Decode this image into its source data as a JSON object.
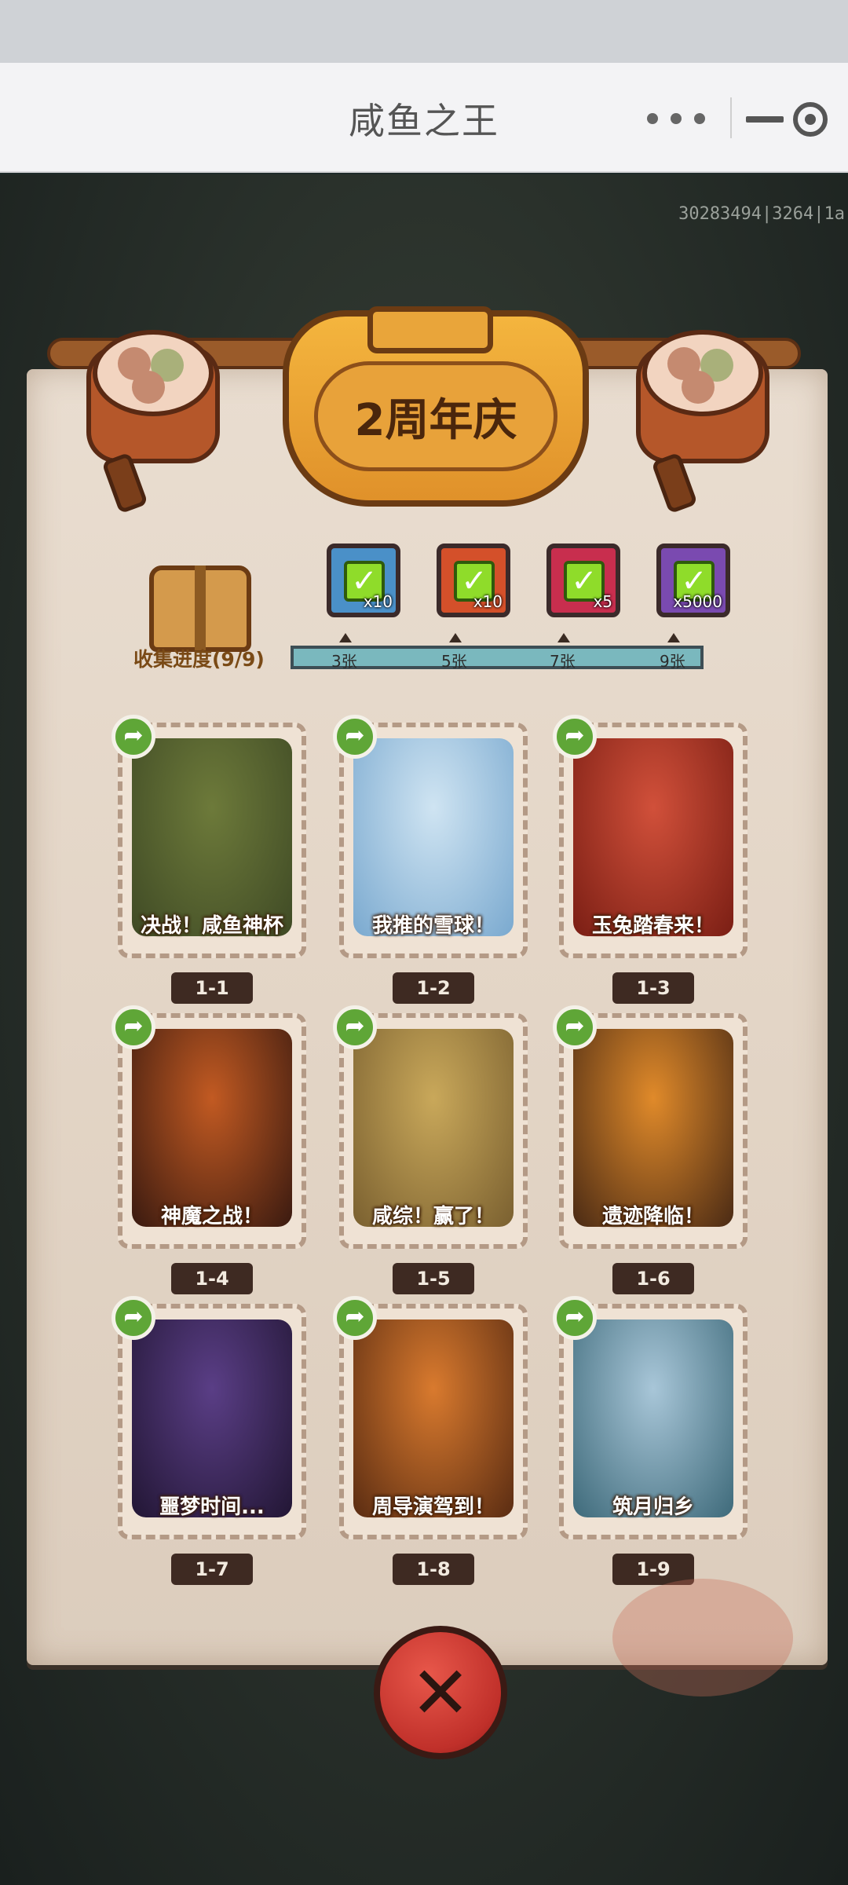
{
  "window": {
    "title": "咸鱼之王",
    "more_icon": "more-dots-icon",
    "minimize_icon": "minimize-icon",
    "close_icon": "target-close-icon"
  },
  "user_id": "30283494|3264|1a",
  "event": {
    "banner_title": "2周年庆"
  },
  "progress": {
    "label": "收集进度(9/9)",
    "collected": 9,
    "total": 9,
    "milestones": [
      {
        "reward_icon": "equipment-chest-icon",
        "qty": "x10",
        "tick": "3张",
        "claimed": true
      },
      {
        "reward_icon": "key-chest-icon",
        "qty": "x10",
        "tick": "5张",
        "claimed": true
      },
      {
        "reward_icon": "gem-egg-icon",
        "qty": "x5",
        "tick": "7张",
        "claimed": true
      },
      {
        "reward_icon": "silver-ingot-icon",
        "qty": "x5000",
        "tick": "9张",
        "claimed": true
      }
    ]
  },
  "cards": [
    {
      "caption": "决战！咸鱼神杯",
      "level": "1-1",
      "bg": [
        "#6d7a3a",
        "#3f4a25"
      ]
    },
    {
      "caption": "我推的雪球！",
      "level": "1-2",
      "bg": [
        "#cfe4f2",
        "#7aa9cf"
      ]
    },
    {
      "caption": "玉兔踏春来！",
      "level": "1-3",
      "bg": [
        "#d1503a",
        "#7a1e14"
      ]
    },
    {
      "caption": "神魔之战！",
      "level": "1-4",
      "bg": [
        "#c25a22",
        "#3a1a10"
      ]
    },
    {
      "caption": "咸综！赢了！",
      "level": "1-5",
      "bg": [
        "#c9a85a",
        "#7a6030"
      ]
    },
    {
      "caption": "遗迹降临！",
      "level": "1-6",
      "bg": [
        "#e08a2a",
        "#4a2a14"
      ]
    },
    {
      "caption": "噩梦时间...",
      "level": "1-7",
      "bg": [
        "#5a3e86",
        "#221634"
      ]
    },
    {
      "caption": "周导演驾到！",
      "level": "1-8",
      "bg": [
        "#d97a2e",
        "#5a2c12"
      ]
    },
    {
      "caption": "筑月归乡",
      "level": "1-9",
      "bg": [
        "#a8c6d8",
        "#3e6a7a"
      ]
    }
  ],
  "share_icon": "share-arrow-icon",
  "close_button_icon": "close-x-icon"
}
